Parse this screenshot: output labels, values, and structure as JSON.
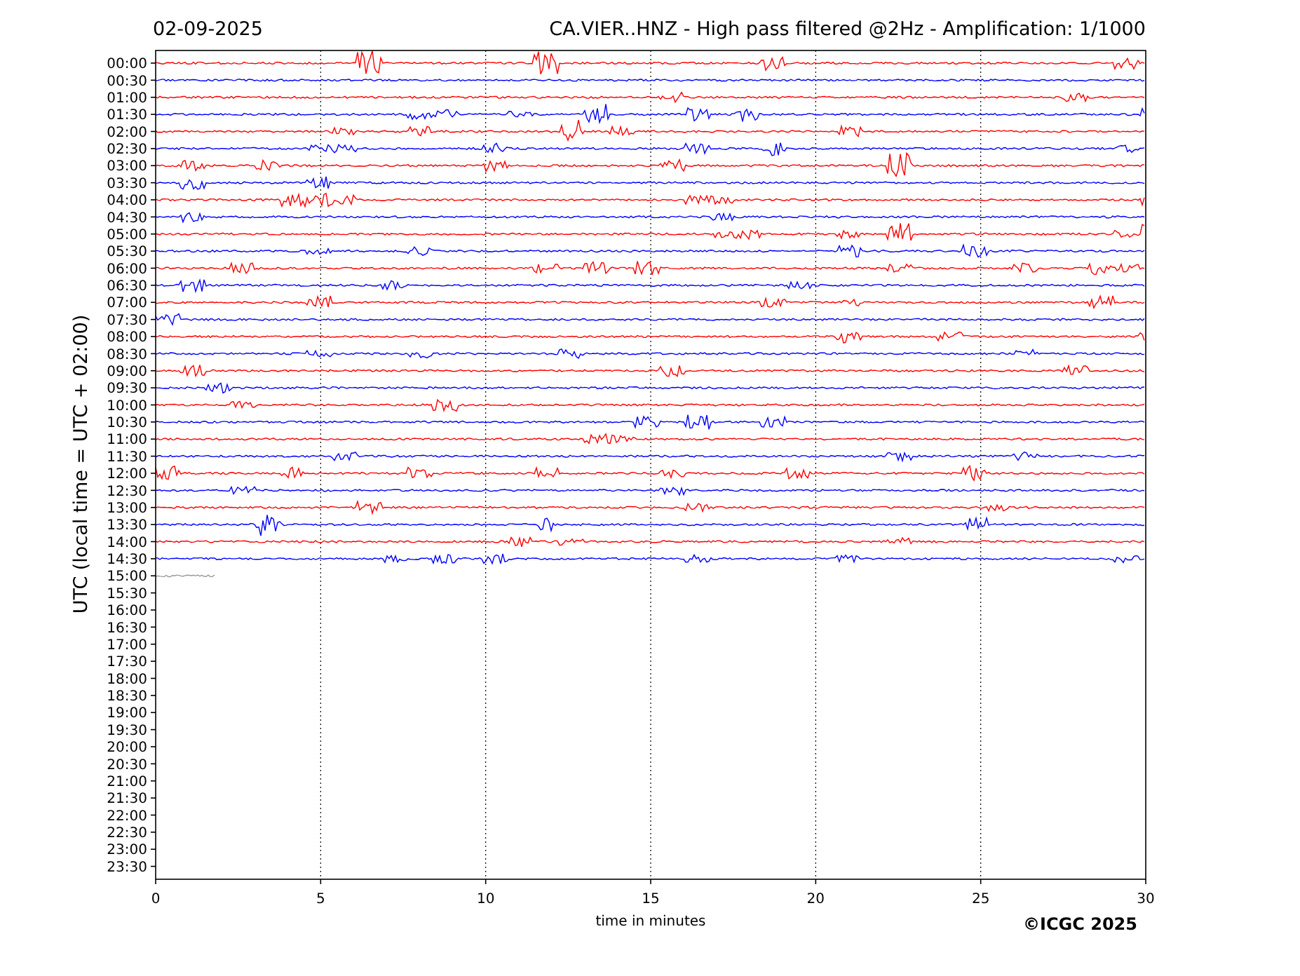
{
  "header": {
    "date": "02-09-2025",
    "title": "CA.VIER..HNZ - High pass filtered @2Hz - Amplification: 1/1000"
  },
  "plot": {
    "ylabel": "UTC (local time = UTC + 02:00)",
    "xlabel": "time in minutes",
    "xticks": [
      "0",
      "5",
      "10",
      "15",
      "20",
      "25",
      "30"
    ],
    "rows": [
      {
        "label": "00:00",
        "kind": "full",
        "color": "#ff0000"
      },
      {
        "label": "00:30",
        "kind": "full",
        "color": "#0000ff"
      },
      {
        "label": "01:00",
        "kind": "full",
        "color": "#ff0000"
      },
      {
        "label": "01:30",
        "kind": "full",
        "color": "#0000ff"
      },
      {
        "label": "02:00",
        "kind": "full",
        "color": "#ff0000"
      },
      {
        "label": "02:30",
        "kind": "full",
        "color": "#0000ff"
      },
      {
        "label": "03:00",
        "kind": "full",
        "color": "#ff0000"
      },
      {
        "label": "03:30",
        "kind": "full",
        "color": "#0000ff"
      },
      {
        "label": "04:00",
        "kind": "full",
        "color": "#ff0000"
      },
      {
        "label": "04:30",
        "kind": "full",
        "color": "#0000ff"
      },
      {
        "label": "05:00",
        "kind": "full",
        "color": "#ff0000"
      },
      {
        "label": "05:30",
        "kind": "full",
        "color": "#0000ff"
      },
      {
        "label": "06:00",
        "kind": "full",
        "color": "#ff0000"
      },
      {
        "label": "06:30",
        "kind": "full",
        "color": "#0000ff"
      },
      {
        "label": "07:00",
        "kind": "full",
        "color": "#ff0000"
      },
      {
        "label": "07:30",
        "kind": "full",
        "color": "#0000ff"
      },
      {
        "label": "08:00",
        "kind": "full",
        "color": "#ff0000"
      },
      {
        "label": "08:30",
        "kind": "full",
        "color": "#0000ff"
      },
      {
        "label": "09:00",
        "kind": "full",
        "color": "#ff0000"
      },
      {
        "label": "09:30",
        "kind": "full",
        "color": "#0000ff"
      },
      {
        "label": "10:00",
        "kind": "full",
        "color": "#ff0000"
      },
      {
        "label": "10:30",
        "kind": "full",
        "color": "#0000ff"
      },
      {
        "label": "11:00",
        "kind": "full",
        "color": "#ff0000"
      },
      {
        "label": "11:30",
        "kind": "full",
        "color": "#0000ff"
      },
      {
        "label": "12:00",
        "kind": "full",
        "color": "#ff0000"
      },
      {
        "label": "12:30",
        "kind": "full",
        "color": "#0000ff"
      },
      {
        "label": "13:00",
        "kind": "full",
        "color": "#ff0000"
      },
      {
        "label": "13:30",
        "kind": "full",
        "color": "#0000ff"
      },
      {
        "label": "14:00",
        "kind": "full",
        "color": "#ff0000"
      },
      {
        "label": "14:30",
        "kind": "full",
        "color": "#0000ff"
      },
      {
        "label": "15:00",
        "kind": "partial",
        "color": "#999999",
        "level": 0.06
      },
      {
        "label": "15:30",
        "kind": "empty"
      },
      {
        "label": "16:00",
        "kind": "empty"
      },
      {
        "label": "16:30",
        "kind": "empty"
      },
      {
        "label": "17:00",
        "kind": "empty"
      },
      {
        "label": "17:30",
        "kind": "empty"
      },
      {
        "label": "18:00",
        "kind": "empty"
      },
      {
        "label": "18:30",
        "kind": "empty"
      },
      {
        "label": "19:00",
        "kind": "empty"
      },
      {
        "label": "19:30",
        "kind": "empty"
      },
      {
        "label": "20:00",
        "kind": "empty"
      },
      {
        "label": "20:30",
        "kind": "empty"
      },
      {
        "label": "21:00",
        "kind": "empty"
      },
      {
        "label": "21:30",
        "kind": "empty"
      },
      {
        "label": "22:00",
        "kind": "empty"
      },
      {
        "label": "22:30",
        "kind": "empty"
      },
      {
        "label": "23:00",
        "kind": "empty"
      },
      {
        "label": "23:30",
        "kind": "empty"
      }
    ]
  },
  "credit": "©ICGC 2025"
}
